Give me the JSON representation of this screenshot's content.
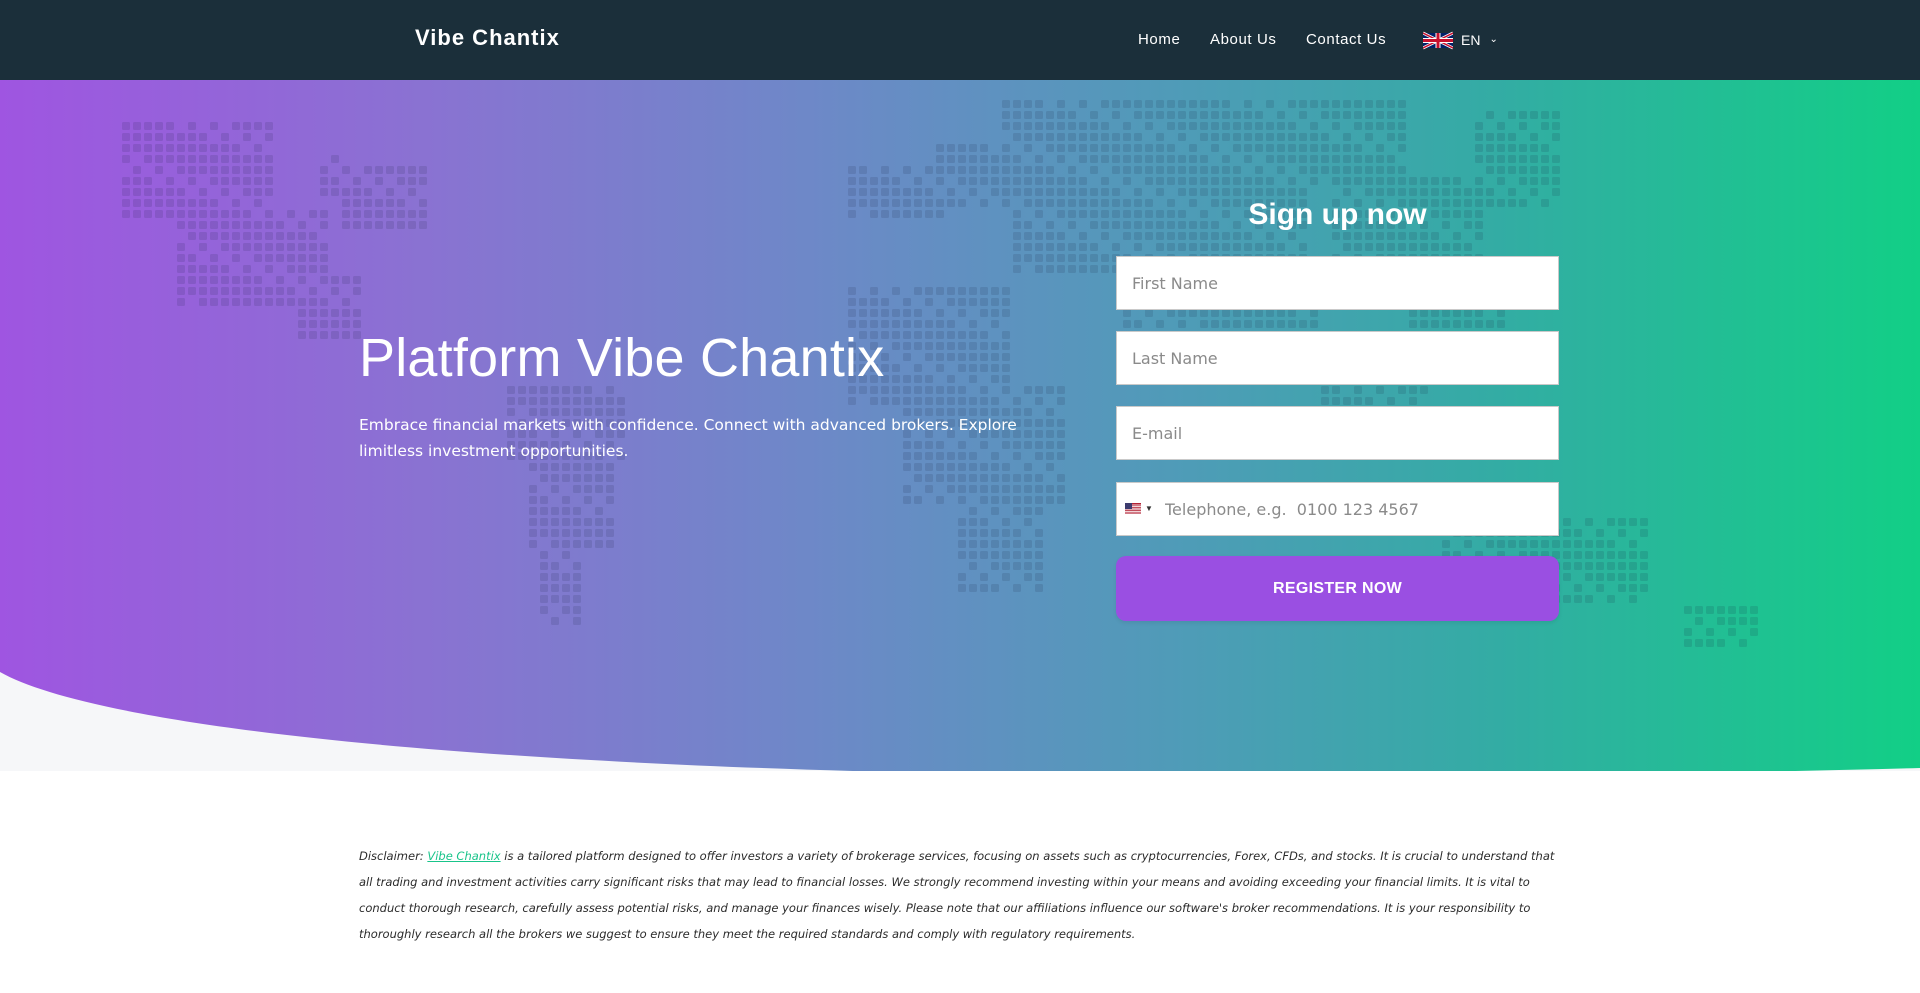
{
  "header": {
    "logo": "Vibe Chantix",
    "nav": [
      {
        "label": "Home"
      },
      {
        "label": "About Us"
      },
      {
        "label": "Contact Us"
      }
    ],
    "language": {
      "code": "EN",
      "flag_icon": "uk-flag-icon",
      "chevron_icon": "chevron-down-icon"
    }
  },
  "hero": {
    "title": "Platform Vibe Chantix",
    "subtitle": "Embrace financial markets with confidence. Connect with advanced brokers. Explore limitless investment opportunities."
  },
  "form": {
    "title": "Sign up now",
    "first_name_placeholder": "First Name",
    "last_name_placeholder": "Last Name",
    "email_placeholder": "E-mail",
    "phone_placeholder": "Telephone, e.g.  0100 123 4567",
    "phone_country_icon": "us-flag-icon",
    "register_label": "REGISTER NOW"
  },
  "disclaimer": {
    "prefix": "Disclaimer: ",
    "link_text": "Vibe Chantix",
    "body": " is a tailored platform designed to offer investors a variety of brokerage services, focusing on assets such as cryptocurrencies, Forex, CFDs, and stocks. It is crucial to understand that all trading and investment activities carry significant risks that may lead to financial losses. We strongly recommend investing within your means and avoiding exceeding your financial limits. It is vital to conduct thorough research, carefully assess potential risks, and manage your finances wisely. Please note that our affiliations influence our software's broker recommendations. It is your responsibility to thoroughly research all the brokers we suggest to ensure they meet the required standards and comply with regulatory requirements."
  },
  "colors": {
    "header_bg": "#1b2f3a",
    "gradient_start": "#9f55e1",
    "gradient_end": "#12cf86",
    "button": "#9a4fe2",
    "link": "#19c48a"
  }
}
